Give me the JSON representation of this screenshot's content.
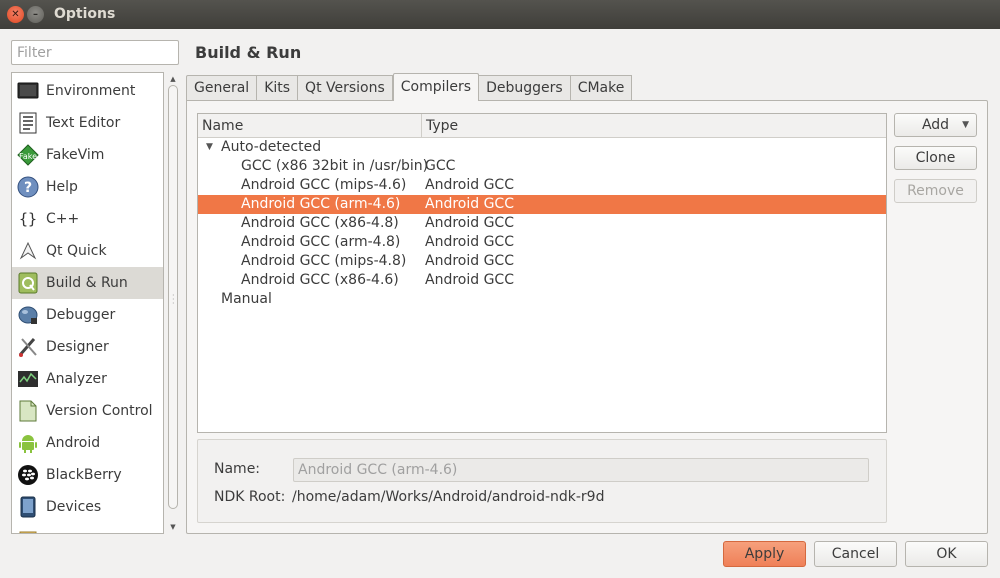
{
  "window": {
    "title": "Options"
  },
  "filter": {
    "placeholder": "Filter"
  },
  "categories": [
    {
      "label": "Environment",
      "icon": "monitor-icon"
    },
    {
      "label": "Text Editor",
      "icon": "text-editor-icon"
    },
    {
      "label": "FakeVim",
      "icon": "fakevim-icon"
    },
    {
      "label": "Help",
      "icon": "help-icon"
    },
    {
      "label": "C++",
      "icon": "cpp-braces-icon"
    },
    {
      "label": "Qt Quick",
      "icon": "qt-quick-icon"
    },
    {
      "label": "Build & Run",
      "icon": "build-run-icon",
      "selected": true
    },
    {
      "label": "Debugger",
      "icon": "debugger-icon"
    },
    {
      "label": "Designer",
      "icon": "designer-icon"
    },
    {
      "label": "Analyzer",
      "icon": "analyzer-icon"
    },
    {
      "label": "Version Control",
      "icon": "version-control-icon"
    },
    {
      "label": "Android",
      "icon": "android-icon"
    },
    {
      "label": "BlackBerry",
      "icon": "blackberry-icon"
    },
    {
      "label": "Devices",
      "icon": "devices-icon"
    }
  ],
  "page": {
    "title": "Build & Run"
  },
  "tabs": [
    {
      "label": "General"
    },
    {
      "label": "Kits"
    },
    {
      "label": "Qt Versions"
    },
    {
      "label": "Compilers",
      "active": true
    },
    {
      "label": "Debuggers"
    },
    {
      "label": "CMake"
    }
  ],
  "tree": {
    "columns": {
      "name": "Name",
      "type": "Type"
    },
    "auto_detected_label": "Auto-detected",
    "manual_label": "Manual",
    "rows": [
      {
        "name": "GCC (x86 32bit in /usr/bin)",
        "type": "GCC"
      },
      {
        "name": "Android GCC (mips-4.6)",
        "type": "Android GCC"
      },
      {
        "name": "Android GCC (arm-4.6)",
        "type": "Android GCC",
        "selected": true
      },
      {
        "name": "Android GCC (x86-4.8)",
        "type": "Android GCC"
      },
      {
        "name": "Android GCC (arm-4.8)",
        "type": "Android GCC"
      },
      {
        "name": "Android GCC (mips-4.8)",
        "type": "Android GCC"
      },
      {
        "name": "Android GCC (x86-4.6)",
        "type": "Android GCC"
      }
    ]
  },
  "actions": {
    "add": "Add",
    "clone": "Clone",
    "remove": "Remove"
  },
  "details": {
    "name_label": "Name:",
    "name_value": "Android GCC (arm-4.6)",
    "ndk_label": "NDK Root:",
    "ndk_value": "/home/adam/Works/Android/android-ndk-r9d"
  },
  "dialog_buttons": {
    "apply": "Apply",
    "cancel": "Cancel",
    "ok": "OK"
  },
  "colors": {
    "selection": "#f07746",
    "titlebar": "#3f3e3a",
    "close_button": "#e0461e"
  }
}
